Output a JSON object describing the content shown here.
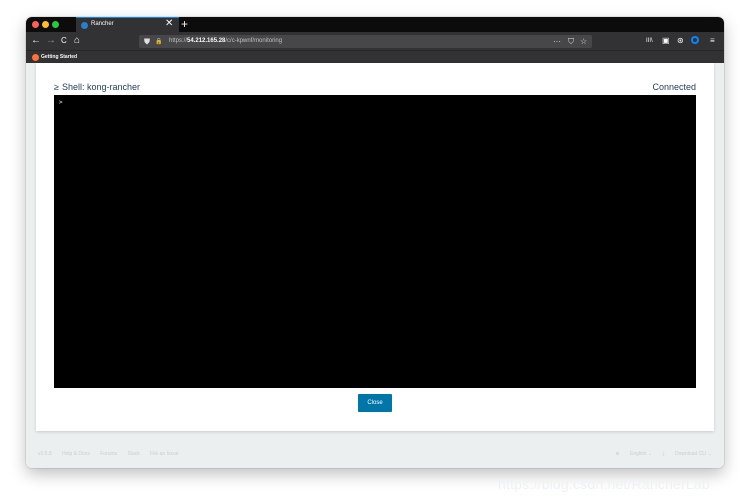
{
  "browser": {
    "tab": {
      "title": "Rancher"
    },
    "url": {
      "prefix": "https://",
      "host": "54.212.165.28",
      "path": "/c/c-kpwnf/monitoring"
    },
    "bookmarks": [
      {
        "label": "Getting Started"
      }
    ],
    "icons": {
      "back": "←",
      "forward": "→",
      "reload": "C",
      "home": "⌂",
      "more": "···",
      "pocket": "⛉",
      "star": "☆",
      "library": "III\\",
      "sidebar": "▣",
      "account": "⊛",
      "menu": "≡",
      "shield": "⛊",
      "lock": "🔒",
      "close": "✕",
      "new_tab": "+"
    }
  },
  "shell": {
    "prompt_icon": "≥",
    "title": "Shell: kong-rancher",
    "status": "Connected",
    "terminal_line": ">",
    "close_label": "Close"
  },
  "footer": {
    "version": "v2.5.8",
    "links": [
      "Help & Docs",
      "Forums",
      "Slack",
      "File an Issue"
    ],
    "language": "English",
    "download": "Download CLI"
  },
  "watermark": "https://blog.csdn.net/RancherLab"
}
